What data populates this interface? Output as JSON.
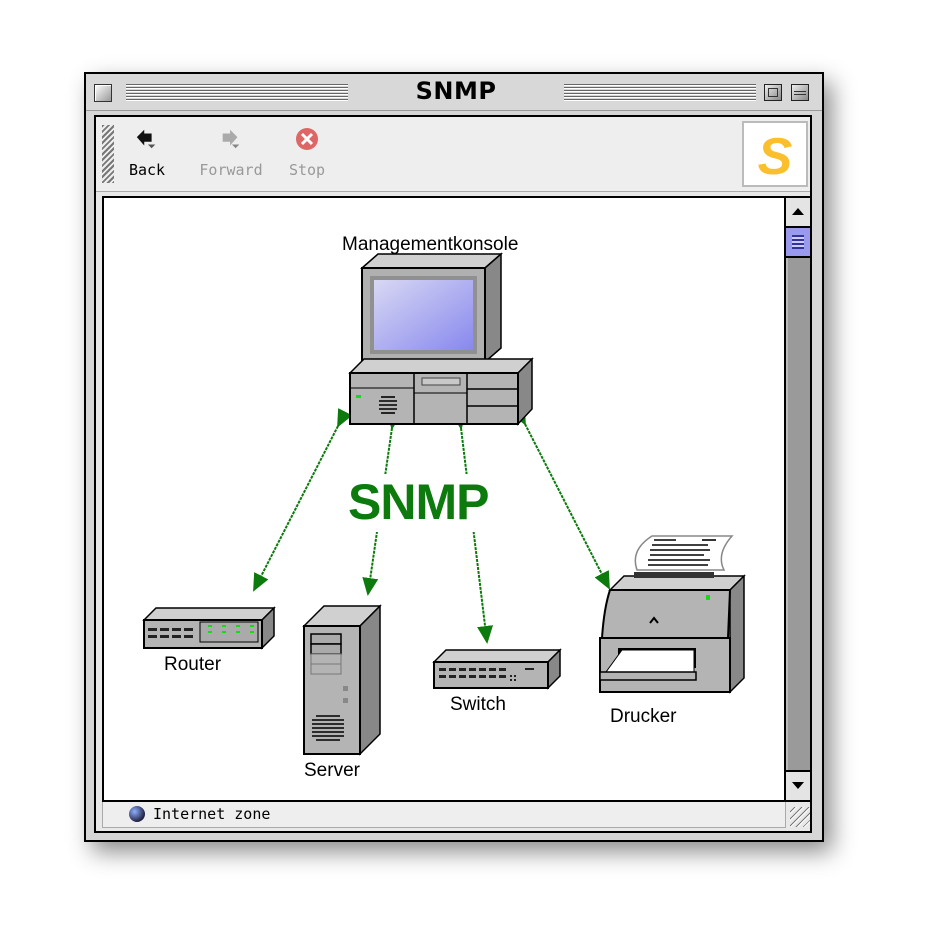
{
  "window": {
    "title": "SNMP"
  },
  "toolbar": {
    "back_label": "Back",
    "forward_label": "Forward",
    "stop_label": "Stop",
    "back_enabled": true,
    "forward_enabled": false,
    "stop_enabled": false,
    "logo_letter": "S",
    "logo_color": "#fbbf2e"
  },
  "diagram": {
    "center_label": "SNMP",
    "center_color": "#0c7a0c",
    "nodes": {
      "console": "Managementkonsole",
      "router": "Router",
      "server": "Server",
      "switch": "Switch",
      "printer": "Drucker"
    },
    "arrow_color": "#0c7a0c"
  },
  "statusbar": {
    "zone_text": "Internet zone",
    "zone_icon": "globe-icon"
  },
  "scrollbar": {
    "position": 0
  }
}
